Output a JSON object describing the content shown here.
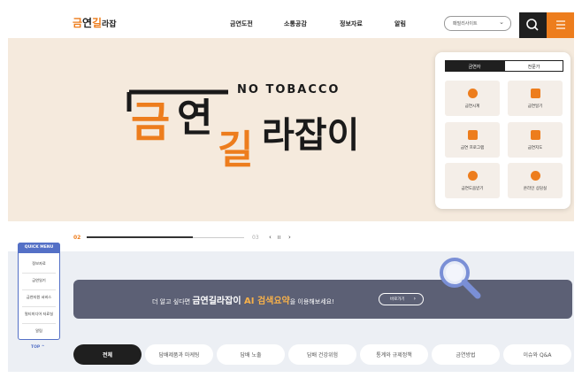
{
  "header": {
    "logo_text": "금연길라잡이",
    "nav": [
      "금연도전",
      "소통공감",
      "정보자료",
      "알림"
    ],
    "family_site": "패밀리사이트"
  },
  "hero": {
    "slogan": "NO TOBACCO",
    "title_parts": [
      "금",
      "연",
      "길",
      "라잡이"
    ]
  },
  "panel": {
    "tabs": [
      "금연자",
      "전문가"
    ],
    "items": [
      {
        "label": "금연시계",
        "icon": "clock-icon"
      },
      {
        "label": "금연일기",
        "icon": "diary-icon"
      },
      {
        "label": "금연 프로그램",
        "icon": "calendar-icon"
      },
      {
        "label": "금연지도",
        "icon": "map-icon"
      },
      {
        "label": "금연도움받기",
        "icon": "help-icon"
      },
      {
        "label": "온라인 상담실",
        "icon": "chat-icon"
      }
    ]
  },
  "slider": {
    "current": "02",
    "total": "03",
    "prev": "‹",
    "pause": "II",
    "next": "›"
  },
  "quick_menu": {
    "title": "QUICK MENU",
    "items": [
      "정보자료",
      "금연일기",
      "금연지원 서비스",
      "멀티미디어 자료실",
      "알림"
    ],
    "top": "TOP ^"
  },
  "ai_banner": {
    "prefix": "더 알고 싶다면 ",
    "brand": "금연길라잡이 ",
    "highlight": "AI 검색요약",
    "suffix": "을 이용해보세요!",
    "button": "바로가기"
  },
  "categories": [
    "전체",
    "담배제품과 마케팅",
    "담배 노출",
    "담배 건강위험",
    "통계와 규제정책",
    "금연방법",
    "이슈와 Q&A"
  ],
  "colors": {
    "accent": "#ed7d1d",
    "dark": "#1f1f1f",
    "quick_menu": "#5470c6",
    "banner": "#5c6075"
  }
}
